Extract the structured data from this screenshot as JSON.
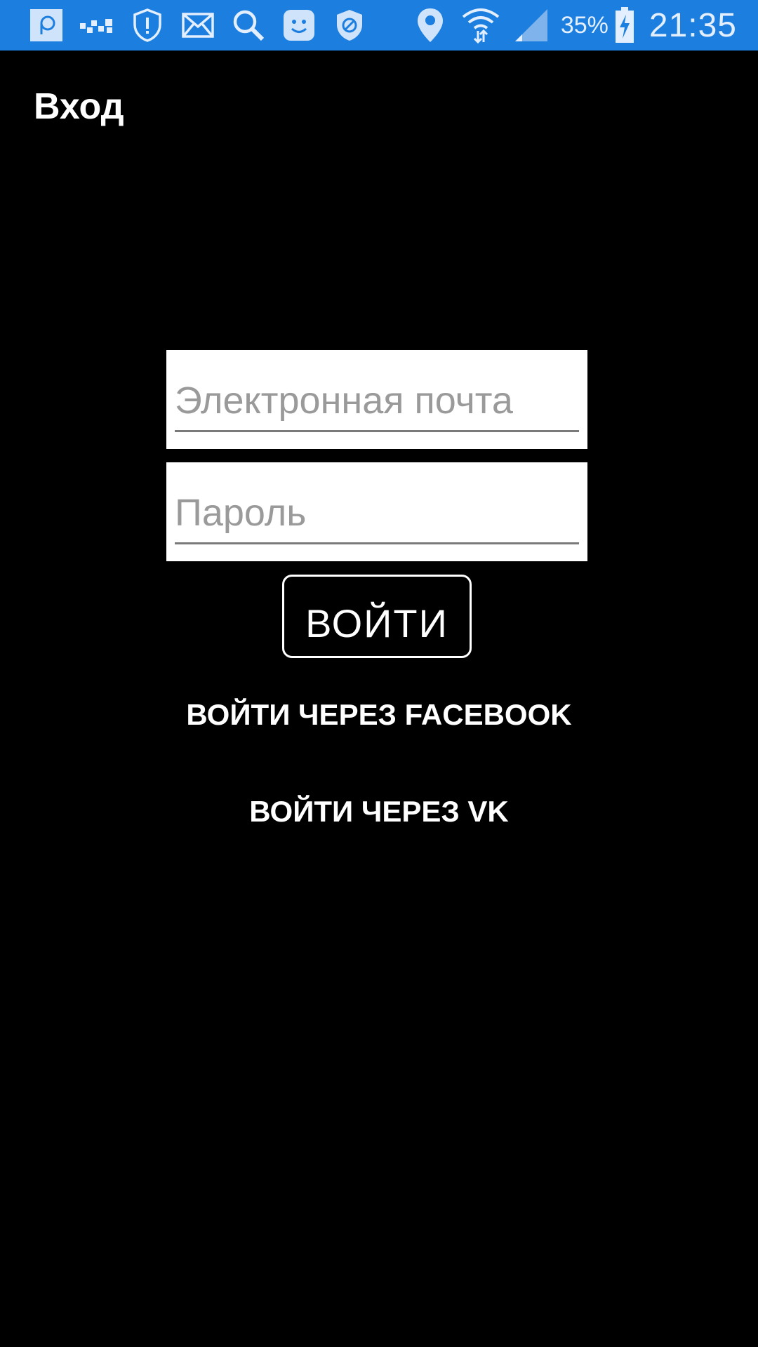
{
  "status_bar": {
    "battery_percent": "35%",
    "time": "21:35",
    "background_color": "#1c7fe0",
    "icons_left": [
      "app-r-icon",
      "dots-icon",
      "shield-alert-icon",
      "mail-icon",
      "search-icon",
      "smiley-icon",
      "shield-block-icon"
    ],
    "icons_right": [
      "location-icon",
      "wifi-icon",
      "signal-icon",
      "battery-charging-icon"
    ]
  },
  "screen": {
    "title": "Вход"
  },
  "form": {
    "email_placeholder": "Электронная почта",
    "email_value": "",
    "password_placeholder": "Пароль",
    "password_value": "",
    "login_label": "ВОЙТИ"
  },
  "social": {
    "facebook_label": "ВОЙТИ ЧЕРЕЗ FACEBOOK",
    "vk_label": "ВОЙТИ ЧЕРЕЗ VK"
  }
}
